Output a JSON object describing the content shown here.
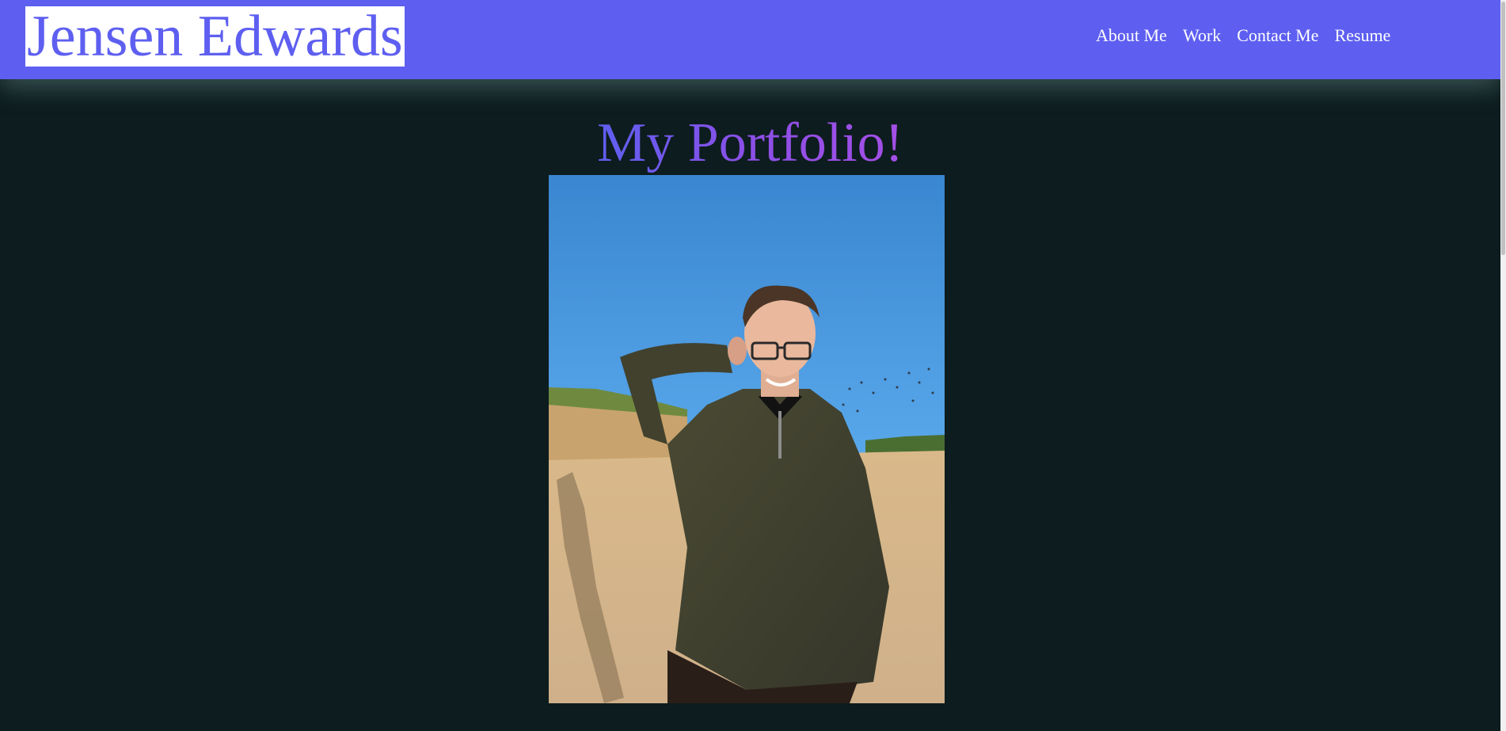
{
  "header": {
    "logo_text": "Jensen Edwards",
    "nav": [
      {
        "label": "About Me"
      },
      {
        "label": "Work"
      },
      {
        "label": "Contact Me"
      },
      {
        "label": "Resume"
      }
    ]
  },
  "main": {
    "title": "My Portfolio!"
  },
  "colors": {
    "header_bg": "#5e5ff0",
    "page_bg": "#0d1c1e",
    "title_gradient_start": "#5e5ff0",
    "title_gradient_end": "#a44fe6"
  }
}
